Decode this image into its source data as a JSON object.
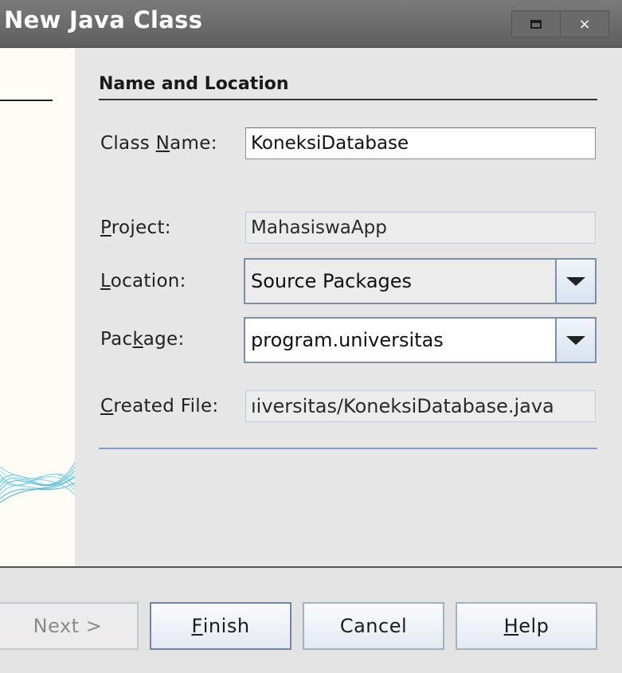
{
  "window": {
    "title": "New Java Class",
    "maximize_icon": "maximize-icon",
    "close_glyph": "×"
  },
  "panel": {
    "section_title": "Name and Location",
    "class_name": {
      "label_pre": "Class ",
      "label_mnemonic": "N",
      "label_post": "ame:",
      "value": "KoneksiDatabase"
    },
    "project": {
      "label_mnemonic": "P",
      "label_post": "roject:",
      "value": "MahasiswaApp"
    },
    "location": {
      "label_mnemonic": "L",
      "label_post": "ocation:",
      "value": "Source Packages"
    },
    "package": {
      "label_pre": "Pac",
      "label_mnemonic": "k",
      "label_post": "age:",
      "value": "program.universitas"
    },
    "created_file": {
      "label_mnemonic": "C",
      "label_post": "reated File:",
      "value": "ıiversitas/KoneksiDatabase.java"
    }
  },
  "buttons": {
    "next": "Next >",
    "finish_mnemonic": "F",
    "finish_rest": "inish",
    "cancel": "Cancel",
    "help_mnemonic": "H",
    "help_rest": "elp"
  },
  "colors": {
    "titlebar": "#6b6b6b",
    "side_panel": "#fdfdf5",
    "accent_rule": "#7f9cc8",
    "wave": "#5ec3e3"
  }
}
